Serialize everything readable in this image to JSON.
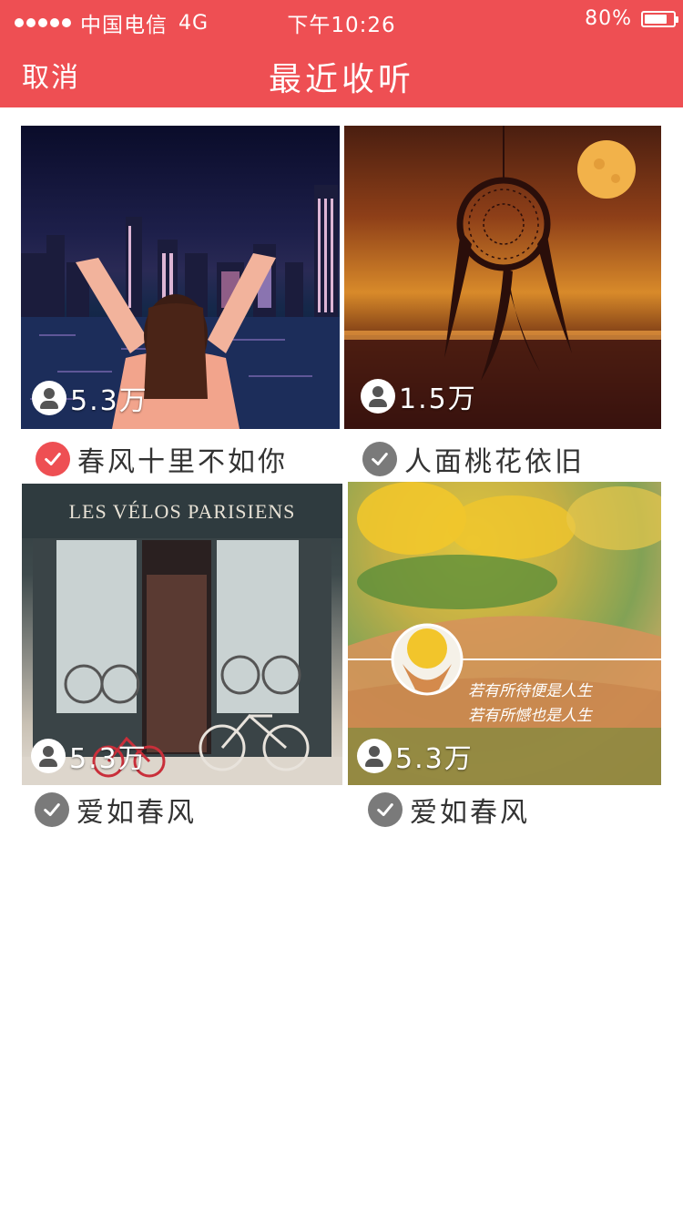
{
  "status_bar": {
    "carrier": "中国电信",
    "network": "4G",
    "time": "下午10:26",
    "battery": "80%",
    "battery_level": 0.8
  },
  "nav": {
    "cancel": "取消",
    "title": "最近收听"
  },
  "items": [
    {
      "listeners": "5.3万",
      "title": "春风十里不如你",
      "selected": true,
      "thumb_icon": "city-night-photo"
    },
    {
      "listeners": "1.5万",
      "title": "人面桃花依旧",
      "selected": false,
      "thumb_icon": "dreamcatcher-sunset-photo"
    },
    {
      "listeners": "5.3万",
      "title": "爱如春风",
      "selected": false,
      "thumb_icon": "bike-shop-photo"
    },
    {
      "listeners": "5.3万",
      "title": "爱如春风",
      "selected": false,
      "thumb_icon": "sunflower-bouquet-photo"
    }
  ],
  "thumb_texts": {
    "shop_sign": "LES VÉLOS PARISIENS",
    "poem_line1": "若有所待便是人生",
    "poem_line2": "若有所憾也是人生"
  },
  "colors": {
    "accent": "#ee4f53",
    "check_selected": "#ee4f53",
    "check_unselected": "#7a7a7a"
  },
  "icons": {
    "signal": "signal-dots-icon",
    "battery": "battery-icon",
    "user": "user-icon",
    "check": "check-circle-icon"
  }
}
